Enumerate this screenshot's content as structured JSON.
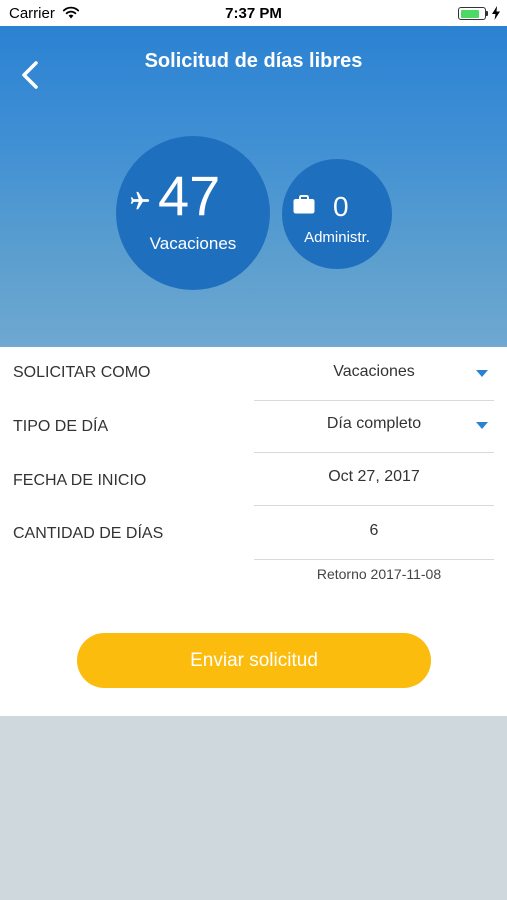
{
  "status_bar": {
    "carrier": "Carrier",
    "time": "7:37 PM",
    "battery_level": 0.85
  },
  "header": {
    "title": "Solicitud de días libres",
    "gradient_top": "#2b82d2",
    "gradient_bottom": "#6fa8d0"
  },
  "balances": {
    "vacaciones": {
      "value": "47",
      "label": "Vacaciones",
      "icon": "airplane-icon"
    },
    "administrativos": {
      "value": "0",
      "label": "Administr.",
      "icon": "briefcase-icon"
    },
    "circle_color": "#1f6fbf"
  },
  "form": {
    "rows": [
      {
        "label": "SOLICITAR COMO",
        "value": "Vacaciones",
        "dropdown": true
      },
      {
        "label": "TIPO DE DÍA",
        "value": "Día completo",
        "dropdown": true
      },
      {
        "label": "FECHA DE INICIO",
        "value": "Oct 27, 2017",
        "dropdown": false
      },
      {
        "label": "CANTIDAD DE DÍAS",
        "value": "6",
        "dropdown": false
      }
    ],
    "return_note": "Retorno 2017-11-08"
  },
  "submit": {
    "label": "Enviar solicitud",
    "color": "#fbbc0d"
  }
}
